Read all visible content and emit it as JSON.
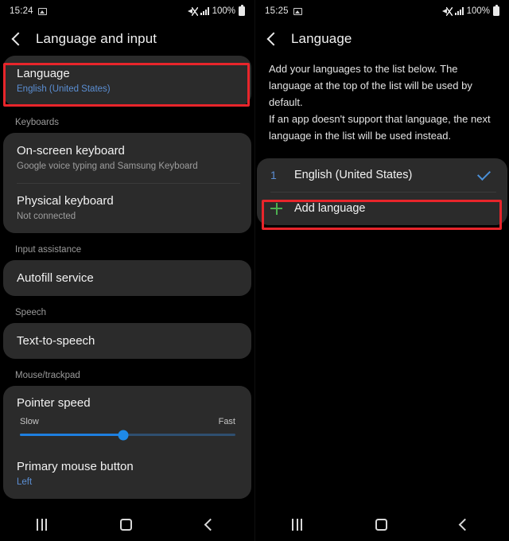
{
  "left_screen": {
    "status_bar": {
      "time": "15:24",
      "photo_icon": "photo-icon",
      "mute_icon": "mute-icon",
      "signal_icon": "signal-bars-icon",
      "battery_percent": "100%",
      "battery_icon": "battery-icon"
    },
    "app_bar": {
      "back_icon": "back-chevron-icon",
      "title": "Language and input"
    },
    "language_item": {
      "title": "Language",
      "subtitle": "English (United States)",
      "highlighted": true
    },
    "sections": [
      {
        "header": "Keyboards",
        "rows": [
          {
            "title": "On-screen keyboard",
            "subtitle": "Google voice typing and Samsung Keyboard"
          },
          {
            "title": "Physical keyboard",
            "subtitle": "Not connected"
          }
        ]
      },
      {
        "header": "Input assistance",
        "rows": [
          {
            "title": "Autofill service",
            "subtitle": ""
          }
        ]
      },
      {
        "header": "Speech",
        "rows": [
          {
            "title": "Text-to-speech",
            "subtitle": ""
          }
        ]
      }
    ],
    "mouse_section": {
      "header": "Mouse/trackpad",
      "pointer_speed": {
        "title": "Pointer speed",
        "min_label": "Slow",
        "max_label": "Fast",
        "value_percent": 48
      },
      "primary_mouse_button": {
        "title": "Primary mouse button",
        "subtitle": "Left"
      }
    },
    "nav_bar": {
      "recents_icon": "recents-icon",
      "home_icon": "home-icon",
      "back_icon": "back-icon"
    }
  },
  "right_screen": {
    "status_bar": {
      "time": "15:25",
      "photo_icon": "photo-icon",
      "mute_icon": "mute-icon",
      "signal_icon": "signal-bars-icon",
      "battery_percent": "100%",
      "battery_icon": "battery-icon"
    },
    "app_bar": {
      "back_icon": "back-chevron-icon",
      "title": "Language"
    },
    "description": "Add your languages to the list below. The language at the top of the list will be used by default.\nIf an app doesn't support that language, the next language in the list will be used instead.",
    "language_list": [
      {
        "index": "1",
        "name": "English (United States)",
        "checked": true
      }
    ],
    "add_language": {
      "label": "Add language",
      "plus_icon": "plus-icon",
      "highlighted": true
    },
    "nav_bar": {
      "recents_icon": "recents-icon",
      "home_icon": "home-icon",
      "back_icon": "back-icon"
    }
  },
  "colors": {
    "accent_blue": "#5b8fd4",
    "slider_blue": "#1e8ae8",
    "check_blue": "#4a90d9",
    "plus_green": "#4caf50",
    "highlight_red": "#e8252b",
    "card_bg": "#2b2b2b",
    "screen_bg": "#000000"
  }
}
